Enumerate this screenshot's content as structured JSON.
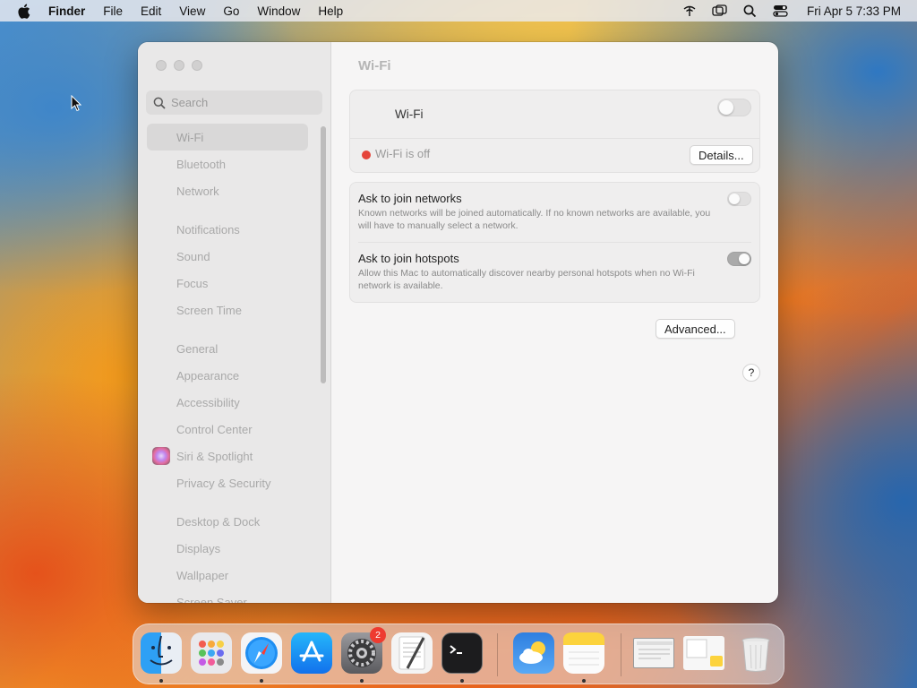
{
  "menubar": {
    "app_name": "Finder",
    "menus": [
      "File",
      "Edit",
      "View",
      "Go",
      "Window",
      "Help"
    ],
    "clock": "Fri Apr 5  7:33 PM",
    "icons": [
      "apple-icon",
      "wifi-off-icon",
      "screen-mirroring-icon",
      "spotlight-search-icon",
      "control-center-icon"
    ]
  },
  "sidebar": {
    "search_placeholder": "Search",
    "groups": [
      {
        "items": [
          {
            "label": "Wi-Fi",
            "selected": true
          },
          {
            "label": "Bluetooth"
          },
          {
            "label": "Network"
          }
        ]
      },
      {
        "items": [
          {
            "label": "Notifications"
          },
          {
            "label": "Sound"
          },
          {
            "label": "Focus"
          },
          {
            "label": "Screen Time"
          }
        ]
      },
      {
        "items": [
          {
            "label": "General"
          },
          {
            "label": "Appearance"
          },
          {
            "label": "Accessibility"
          },
          {
            "label": "Control Center"
          },
          {
            "label": "Siri & Spotlight",
            "icon": "siri-icon"
          },
          {
            "label": "Privacy & Security"
          }
        ]
      },
      {
        "items": [
          {
            "label": "Desktop & Dock"
          },
          {
            "label": "Displays"
          },
          {
            "label": "Wallpaper"
          },
          {
            "label": "Screen Saver"
          }
        ]
      }
    ]
  },
  "content": {
    "title": "Wi-Fi",
    "wifi": {
      "label": "Wi-Fi",
      "enabled": false
    },
    "status": {
      "text": "Wi-Fi is off",
      "color": "#e5443a"
    },
    "details_button": "Details...",
    "options": [
      {
        "title": "Ask to join networks",
        "description": "Known networks will be joined automatically. If no known networks are available, you will have to manually select a network.",
        "enabled": false
      },
      {
        "title": "Ask to join hotspots",
        "description": "Allow this Mac to automatically discover nearby personal hotspots when no Wi-Fi network is available.",
        "enabled": true
      }
    ],
    "advanced_button": "Advanced...",
    "help_button": "?"
  },
  "dock": {
    "apps": [
      {
        "name": "finder-icon",
        "running": true
      },
      {
        "name": "launchpad-icon",
        "running": false
      },
      {
        "name": "safari-icon",
        "running": true
      },
      {
        "name": "app-store-icon",
        "running": false
      },
      {
        "name": "system-settings-icon",
        "running": true,
        "badge": "2"
      },
      {
        "name": "textedit-icon",
        "running": false
      },
      {
        "name": "terminal-icon",
        "running": true
      },
      {
        "name": "weather-icon",
        "running": false
      },
      {
        "name": "notes-icon",
        "running": true
      },
      {
        "name": "minimized-window-icon",
        "running": false
      },
      {
        "name": "downloads-stack-icon",
        "running": false
      },
      {
        "name": "trash-icon",
        "running": false
      }
    ]
  }
}
